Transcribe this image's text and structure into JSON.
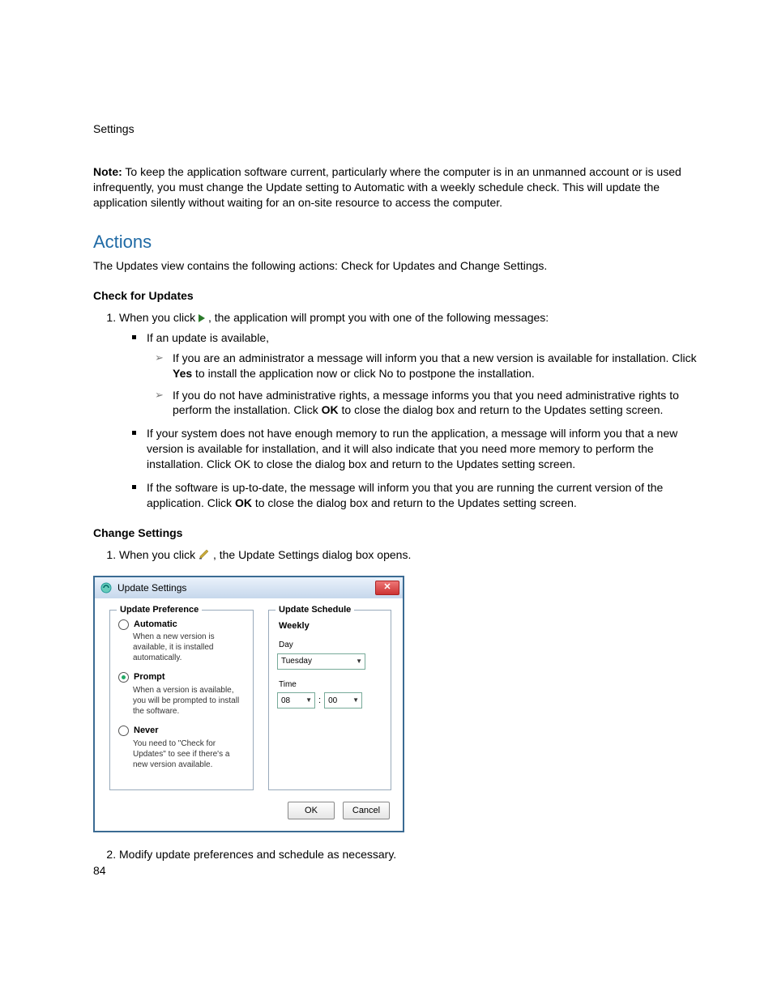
{
  "header": {
    "section": "Settings"
  },
  "note": {
    "label": "Note:",
    "text": " To keep the application software current, particularly where the computer is in an unmanned account or is used infrequently, you must change the Update setting to Automatic with a weekly schedule check. This will update the application silently without waiting for an on-site resource to access the computer."
  },
  "actions": {
    "title": "Actions",
    "intro": "The Updates view contains the following actions: Check for Updates and Change Settings."
  },
  "check_updates": {
    "title": "Check for Updates",
    "step1_pre": "When you click ",
    "step1_post": " , the application will prompt you with one of the following messages:",
    "bul1": "If an update is available,",
    "sub1a_pre": "If you are an administrator a message will inform you that a new version is available for installation. Click ",
    "sub1a_bold": "Yes",
    "sub1a_post": " to install the application now or click No to postpone the installation.",
    "sub1b_pre": "If you do not have administrative rights, a message informs you that you need administrative rights to perform the installation. Click ",
    "sub1b_bold": "OK",
    "sub1b_post": " to close the dialog box and return to the Updates setting screen.",
    "bul2": "If your system does not have enough memory to run the application, a message will inform you that a new version is available for installation, and it will also indicate that you need more memory to perform the installation. Click OK to close the dialog box and return to the Updates setting screen.",
    "bul3_pre": "If the software is up-to-date, the message will inform you that you are running the current version of the application. Click ",
    "bul3_bold": "OK",
    "bul3_post": " to close the dialog box and return to the Updates setting screen."
  },
  "change_settings": {
    "title": "Change Settings",
    "step1_pre": "When you click  ",
    "step1_post": ", the Update Settings dialog box opens.",
    "step2": "Modify update preferences and schedule as necessary."
  },
  "dialog": {
    "title": "Update Settings",
    "pref_legend": "Update Preference",
    "auto_label": "Automatic",
    "auto_desc": "When a new version is available, it is installed automatically.",
    "prompt_label": "Prompt",
    "prompt_desc": "When a version is available, you will be prompted to install the software.",
    "never_label": "Never",
    "never_desc": "You need to \"Check for Updates\" to see if there's a new version available.",
    "sched_legend": "Update Schedule",
    "weekly": "Weekly",
    "day_label": "Day",
    "day_value": "Tuesday",
    "time_label": "Time",
    "hour_value": "08",
    "minute_value": "00",
    "ok": "OK",
    "cancel": "Cancel"
  },
  "page_number": "84"
}
